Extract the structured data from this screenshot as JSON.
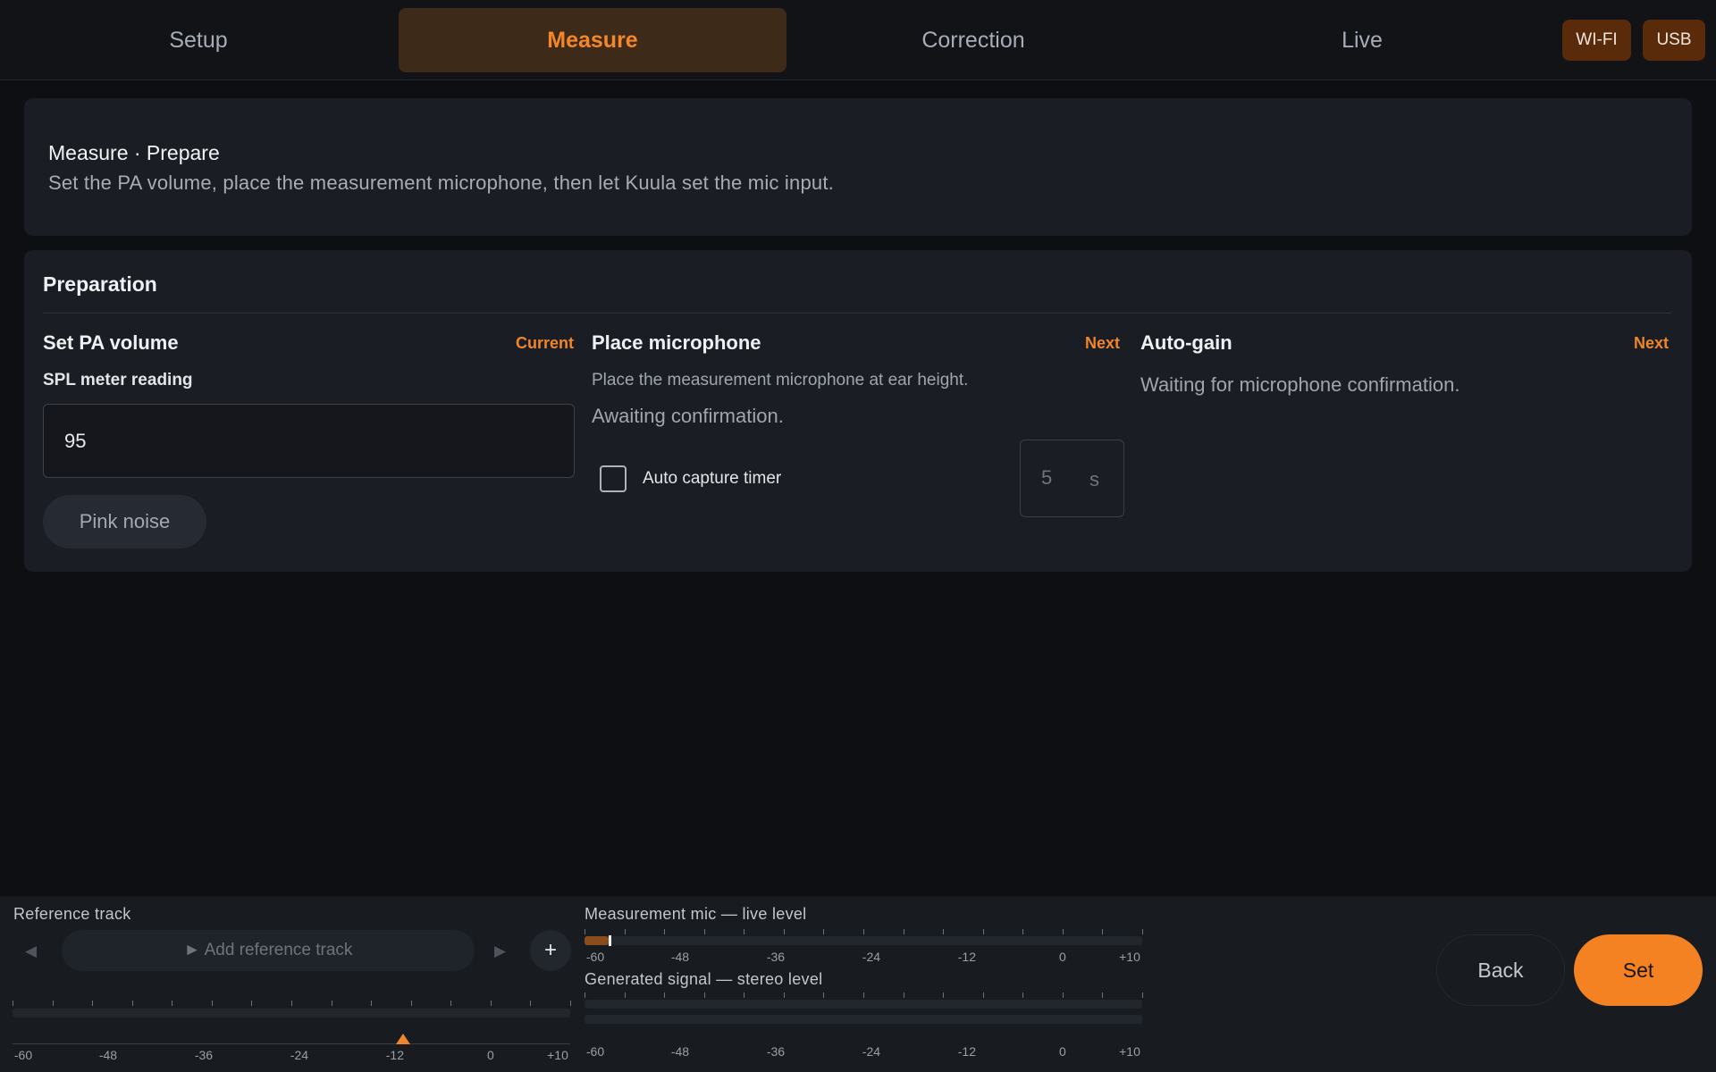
{
  "nav": {
    "tabs": [
      {
        "label": "Setup",
        "active": false
      },
      {
        "label": "Measure",
        "active": true
      },
      {
        "label": "Correction",
        "active": false
      },
      {
        "label": "Live",
        "active": false
      }
    ],
    "connections": [
      "WI-FI",
      "USB"
    ]
  },
  "header": {
    "title": "Measure · Prepare",
    "subtitle": "Set the PA volume, place the measurement microphone, then let Kuula set the mic input."
  },
  "preparation": {
    "title": "Preparation",
    "steps": [
      {
        "title": "Set PA volume",
        "status": "Current",
        "field_label": "SPL meter reading",
        "field_value": "95",
        "button": "Pink noise"
      },
      {
        "title": "Place microphone",
        "status": "Next",
        "hint": "Place the measurement microphone at ear height.",
        "state": "Awaiting confirmation.",
        "checkbox_label": "Auto capture timer",
        "checkbox_checked": false,
        "timer_value": "5",
        "timer_unit": "s"
      },
      {
        "title": "Auto-gain",
        "status": "Next",
        "state": "Waiting for microphone confirmation."
      }
    ]
  },
  "bottom": {
    "reference": {
      "label": "Reference track",
      "prev": "◀",
      "add_label": "► Add reference track",
      "next": "▶",
      "add_button": "+",
      "scale": [
        "-60",
        "-48",
        "-36",
        "-24",
        "-12",
        "0",
        "+10"
      ],
      "marker_db": -11
    },
    "mic": {
      "label": "Measurement mic — live level",
      "level_db": -57,
      "scale": [
        "-60",
        "-48",
        "-36",
        "-24",
        "-12",
        "0",
        "+10"
      ]
    },
    "signal": {
      "label": "Generated signal — stereo level",
      "scale": [
        "-60",
        "-48",
        "-36",
        "-24",
        "-12",
        "0",
        "+10"
      ]
    },
    "back_label": "Back",
    "set_label": "Set"
  },
  "colors": {
    "accent": "#f58222",
    "background": "#0d0f12",
    "card": "#1a1d23"
  }
}
